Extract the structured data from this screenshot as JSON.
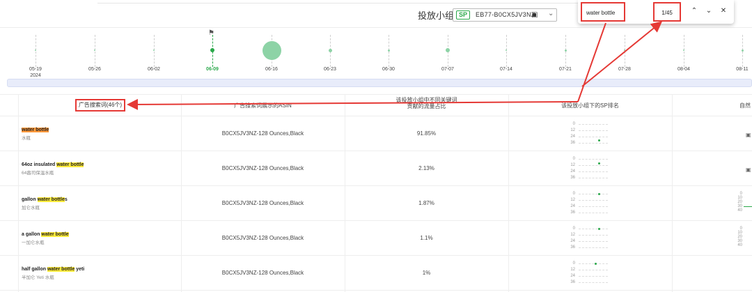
{
  "header": {
    "group_label": "投放小组",
    "sp_tag": "SP",
    "group_value": "EB77-B0CX5JV3NZ"
  },
  "find": {
    "query": "water bottle",
    "count": "1/45",
    "prev_glyph": "⌃",
    "next_glyph": "⌄",
    "close_glyph": "✕"
  },
  "timeline": {
    "dates": [
      {
        "label": "05-19",
        "year": "2024"
      },
      {
        "label": "05-26",
        "year": ""
      },
      {
        "label": "06-02",
        "year": ""
      },
      {
        "label": "06-09",
        "year": ""
      },
      {
        "label": "06-16",
        "year": ""
      },
      {
        "label": "06-23",
        "year": ""
      },
      {
        "label": "06-30",
        "year": ""
      },
      {
        "label": "07-07",
        "year": ""
      },
      {
        "label": "07-14",
        "year": ""
      },
      {
        "label": "07-21",
        "year": ""
      },
      {
        "label": "07-28",
        "year": ""
      },
      {
        "label": "08-04",
        "year": ""
      },
      {
        "label": "08-11",
        "year": ""
      }
    ],
    "active_date": "06-09"
  },
  "table": {
    "headers": {
      "keyword": "广告搜索词(46个)",
      "asin": "广告搜索词展示的ASIN",
      "share": "该投放小组中不同关键词\n贡献的流量占比",
      "rank": "该投放小组下的SP排名",
      "natural": "自然"
    },
    "rows": [
      {
        "pre": "",
        "hl": "water bottle",
        "post": "",
        "sub": "水瓶",
        "asin": "B0CX5JV3NZ-128 Ounces,Black",
        "share": "91.85%",
        "rank": 31
      },
      {
        "pre": "64oz insulated ",
        "hl": "water bottle",
        "post": "",
        "sub": "64盎司保温水瓶",
        "asin": "B0CX5JV3NZ-128 Ounces,Black",
        "share": "2.13%",
        "rank": 9
      },
      {
        "pre": "gallon ",
        "hl": "water bottle",
        "post": "s",
        "sub": "加仑水瓶",
        "asin": "B0CX5JV3NZ-128 Ounces,Black",
        "share": "1.87%",
        "rank": 1
      },
      {
        "pre": "a gallon ",
        "hl": "water bottle",
        "post": "",
        "sub": "一加仑水瓶",
        "asin": "B0CX5JV3NZ-128 Ounces,Black",
        "share": "1.1%",
        "rank": 1
      },
      {
        "pre": "half gallon ",
        "hl": "water bottle",
        "post": " yeti",
        "sub": "半加仑 Yeti 水瓶",
        "asin": "B0CX5JV3NZ-128 Ounces,Black",
        "share": "1%",
        "rank": 1
      }
    ],
    "rank_ticks": [
      "0",
      "12",
      "24",
      "36"
    ],
    "natural_ticks": [
      "0",
      "10",
      "20",
      "30",
      "40"
    ]
  },
  "colors": {
    "accent": "#2aa84a",
    "highlight": "#ffeb3b",
    "highlight_current": "#ff9a3c",
    "annotation_red": "#e53935"
  }
}
